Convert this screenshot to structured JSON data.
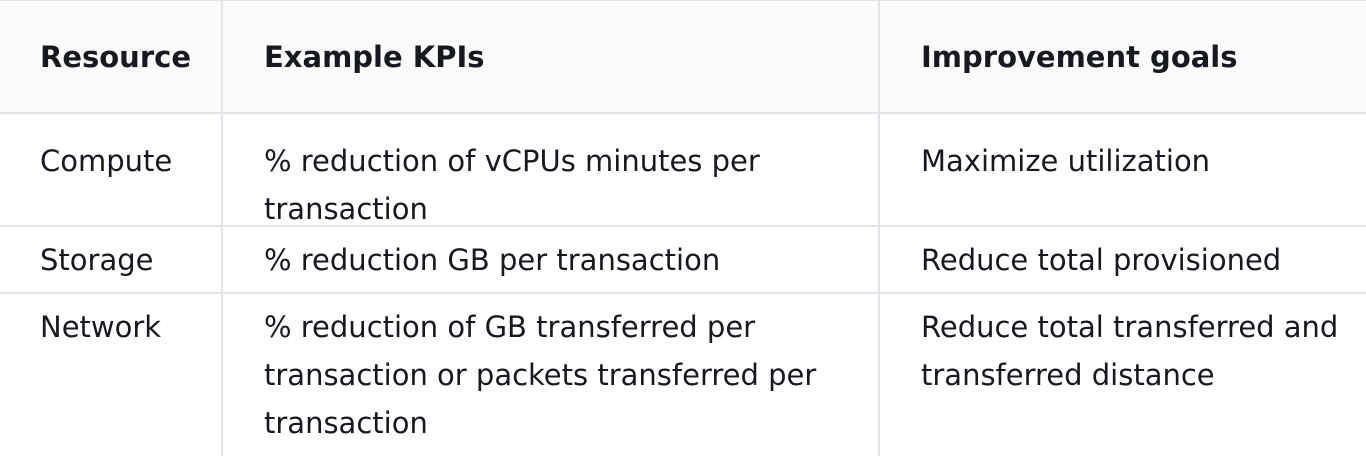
{
  "table": {
    "headers": [
      "Resource",
      "Example KPIs",
      "Improvement goals"
    ],
    "rows": [
      {
        "resource": "Compute",
        "kpi": "% reduction of vCPUs minutes per transaction",
        "goal": "Maximize utilization"
      },
      {
        "resource": "Storage",
        "kpi": "% reduction GB per transaction",
        "goal": "Reduce total provisioned"
      },
      {
        "resource": "Network",
        "kpi": "% reduction of GB transferred per transaction or packets transferred per transaction",
        "goal": "Reduce total transferred and transferred distance"
      }
    ]
  }
}
